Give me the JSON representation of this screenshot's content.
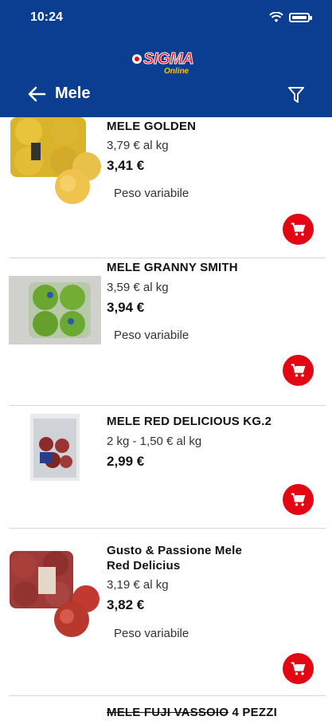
{
  "status_bar": {
    "time": "10:24"
  },
  "brand": {
    "name": "SIGMA",
    "sub": "Online"
  },
  "header": {
    "title": "Mele"
  },
  "products": [
    {
      "name": "MELE GOLDEN",
      "unit_price": "3,79 € al kg",
      "price": "3,41 €",
      "note": "Peso variabile"
    },
    {
      "name": "MELE GRANNY SMITH",
      "unit_price": "3,59 € al kg",
      "price": "3,94 €",
      "note": "Peso variabile"
    },
    {
      "name": "MELE RED DELICIOUS KG.2",
      "unit_price": "2 kg - 1,50 € al kg",
      "price": "2,99 €"
    },
    {
      "name_line1": "Gusto & Passione Mele",
      "name_line2": "Red Delicius",
      "unit_price": "3,19 € al kg",
      "price": "3,82 €",
      "note": "Peso variabile"
    },
    {
      "name_struck": "MELE FUJI VASSOIO",
      "name_rest": " 4 PEZZI"
    }
  ],
  "colors": {
    "header": "#0b3e91",
    "cart": "#e30613"
  }
}
